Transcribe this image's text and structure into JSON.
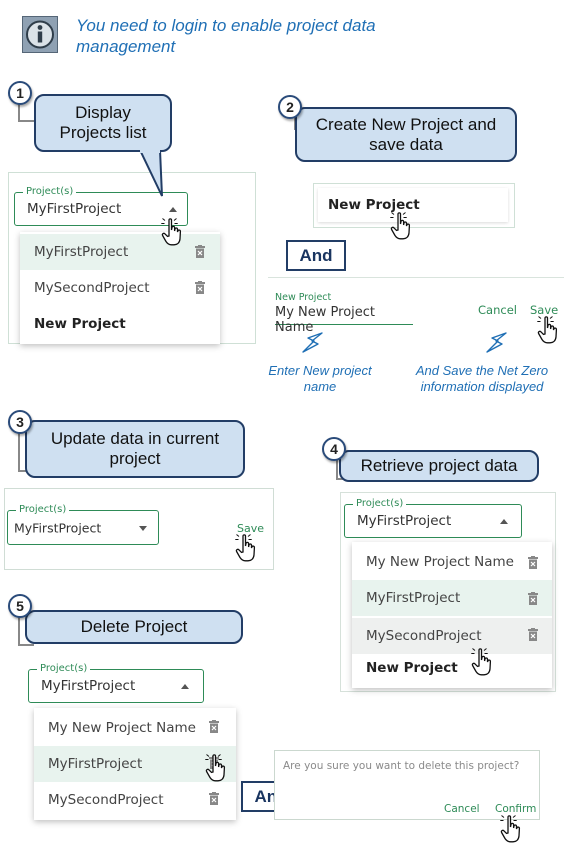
{
  "info": {
    "icon": "info-icon",
    "text": "You need to login to enable project data management"
  },
  "step1": {
    "number": "1",
    "callout": "Display Projects list",
    "field_label": "Project(s)",
    "field_value": "MyFirstProject",
    "items": [
      "MyFirstProject",
      "MySecondProject",
      "New Project"
    ]
  },
  "step2": {
    "number": "2",
    "callout": "Create New Project and save data",
    "menu_item": "New Project",
    "and": "And",
    "input_label": "New Project",
    "input_value": "My New Project Name",
    "cancel": "Cancel",
    "save": "Save",
    "caption_left": "Enter New project name",
    "caption_right": "And Save the Net Zero information displayed"
  },
  "step3": {
    "number": "3",
    "callout": "Update data in current project",
    "field_label": "Project(s)",
    "field_value": "MyFirstProject",
    "save": "Save"
  },
  "step4": {
    "number": "4",
    "callout": "Retrieve project data",
    "field_label": "Project(s)",
    "field_value": "MyFirstProject",
    "items": [
      "My New Project Name",
      "MyFirstProject",
      "MySecondProject",
      "New Project"
    ]
  },
  "step5": {
    "number": "5",
    "callout": "Delete Project",
    "field_label": "Project(s)",
    "field_value": "MyFirstProject",
    "items": [
      "My New Project Name",
      "MyFirstProject",
      "MySecondProject"
    ],
    "and": "And",
    "confirm_text": "Are you sure you want to delete this project?",
    "cancel": "Cancel",
    "confirm": "Confirm"
  }
}
